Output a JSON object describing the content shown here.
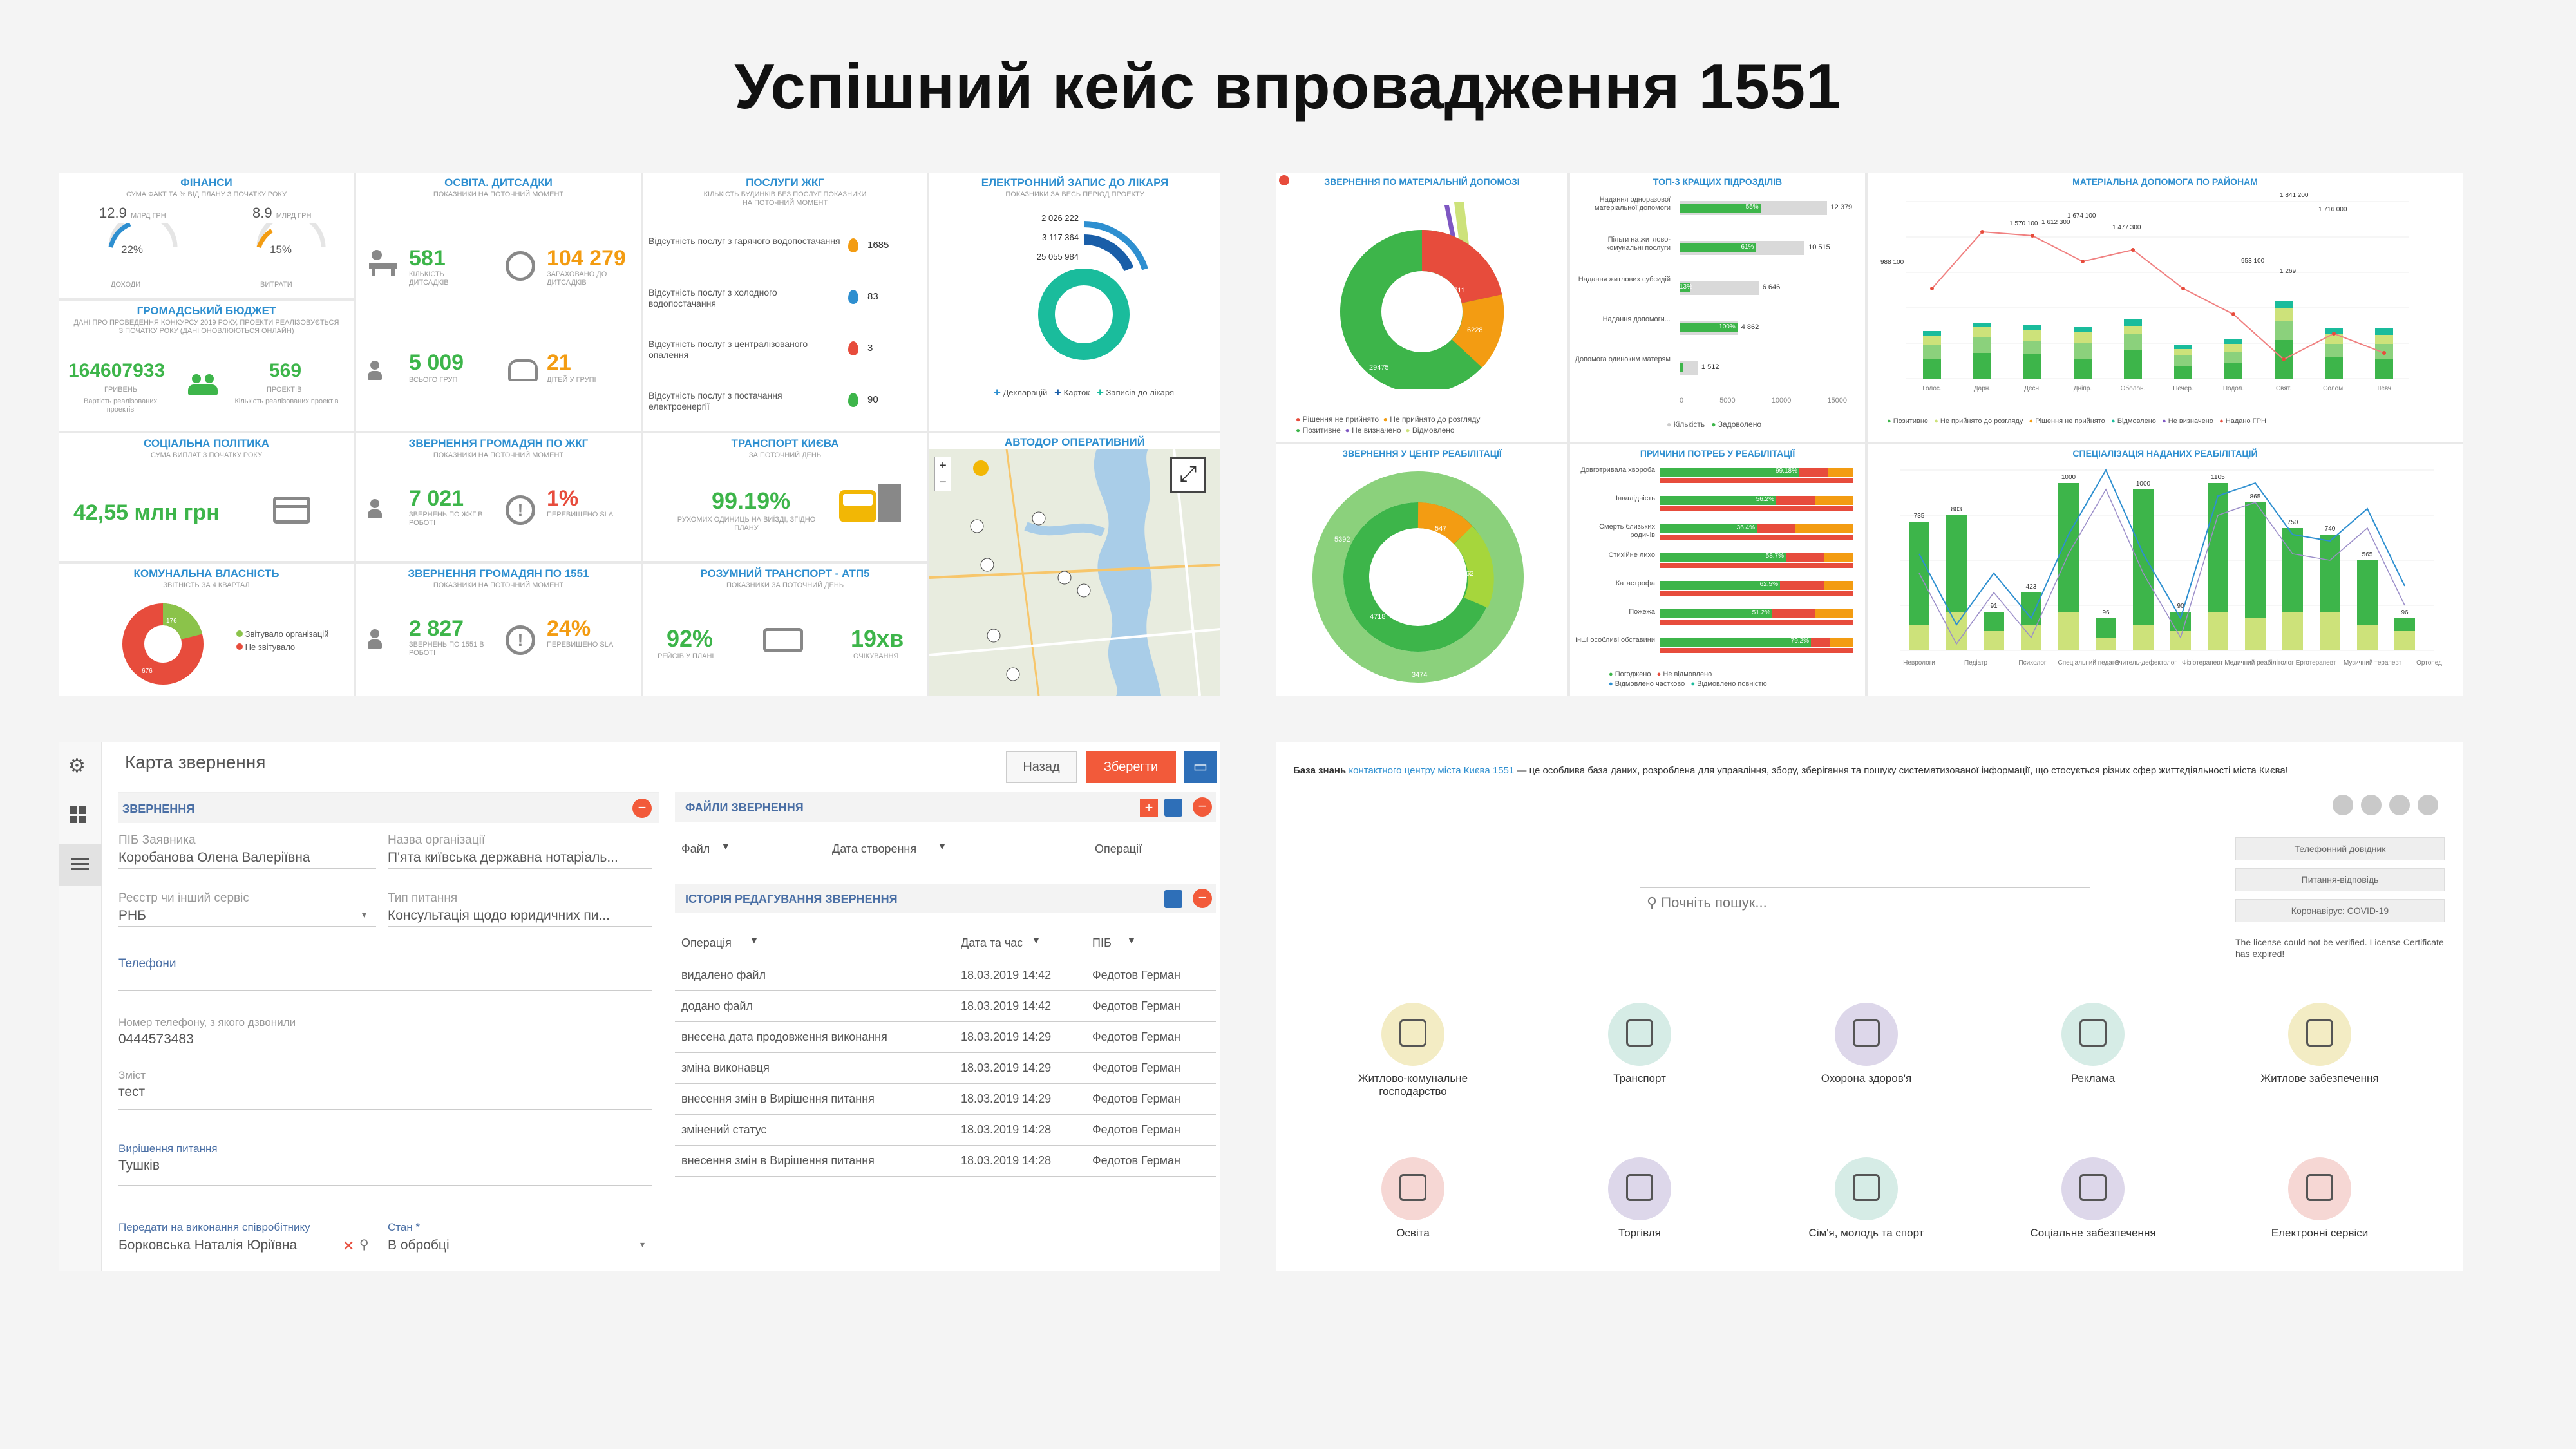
{
  "page_title": "Успішний кейс впровадження 1551",
  "dash1": {
    "finance": {
      "title": "ФІНАНСИ",
      "subtitle": "СУМА ФАКТ ТА % ВІД ПЛАНУ З ПОЧАТКУ РОКУ",
      "left_val": "12.9",
      "left_unit": "млрд грн",
      "right_val": "8.9",
      "right_unit": "млрд грн",
      "left_pct": "22%",
      "right_pct": "15%",
      "left_label": "доходи",
      "right_label": "витрати",
      "left_fill": 0.22,
      "right_fill": 0.15
    },
    "budget": {
      "title": "ГРОМАДСЬКИЙ БЮДЖЕТ",
      "subtitle": "ДАНІ ПРО ПРОВЕДЕННЯ КОНКУРСУ 2019 РОКУ, ПРОЕКТИ РЕАЛІЗОВУЄТЬСЯ З ПОЧАТКУ РОКУ (дані оновлюються онлайн)",
      "amount": "164607933",
      "amount_label": "ГРИВЕНЬ",
      "amount_note": "Вартість реалізованих проектів",
      "projects": "569",
      "projects_label": "ПРОЕКТІВ",
      "projects_note": "Кількість реалізованих проектів"
    },
    "social": {
      "title": "СОЦІАЛЬНА ПОЛІТИКА",
      "subtitle": "СУМА ВИПЛАТ З ПОЧАТКУ РОКУ",
      "value": "42,55 млн грн"
    },
    "communal": {
      "title": "КОМУНАЛЬНА ВЛАСНІСТЬ",
      "subtitle": "ЗВІТНІСТЬ ЗА 4 КВАРТАЛ",
      "leg1": "Звітувало організацій",
      "leg2": "Не звітувало",
      "v1": "176",
      "v2": "676",
      "share": 0.21
    },
    "education": {
      "title": "ОСВІТА. ДИТСАДКИ",
      "subtitle": "ПОКАЗНИКИ НА ПОТОЧНИЙ МОМЕНТ",
      "n1": "581",
      "l1": "КІЛЬКІСТЬ ДИТСАДКІВ",
      "n2": "104 279",
      "l2": "ЗАРАХОВАНО ДО ДИТСАДКІВ",
      "n3": "5 009",
      "l3": "ВСЬОГО ГРУП",
      "n4": "21",
      "l4": "ДІТЕЙ У ГРУПІ"
    },
    "appeals_zhkg": {
      "title": "ЗВЕРНЕННЯ ГРОМАДЯН ПО ЖКГ",
      "subtitle": "ПОКАЗНИКИ НА ПОТОЧНИЙ МОМЕНТ",
      "n1": "7 021",
      "l1": "ЗВЕРНЕНЬ ПО ЖКГ В РОБОТІ",
      "n2": "1%",
      "l2": "ПЕРЕВИЩЕНО SLA"
    },
    "appeals_1551": {
      "title": "ЗВЕРНЕННЯ ГРОМАДЯН ПО 1551",
      "subtitle": "ПОКАЗНИКИ НА ПОТОЧНИЙ МОМЕНТ",
      "n1": "2 827",
      "l1": "ЗВЕРНЕНЬ ПО 1551 В РОБОТІ",
      "n2": "24%",
      "l2": "ПЕРЕВИЩЕНО SLA"
    },
    "housing": {
      "title": "ПОСЛУГИ ЖКГ",
      "subtitle": "КІЛЬКІСТЬ БУДИНКІВ БЕЗ ПОСЛУГ ПОКАЗНИКИ НА ПОТОЧНИЙ МОМЕНТ",
      "rows": [
        {
          "label": "Відсутність послуг з гарячого водопостачання",
          "value": "1685"
        },
        {
          "label": "Відсутність послуг з холодного водопостачання",
          "value": "83"
        },
        {
          "label": "Відсутність послуг з централізованого опалення",
          "value": "3"
        },
        {
          "label": "Відсутність послуг з постачання електроенергії",
          "value": "90"
        }
      ]
    },
    "transport": {
      "title": "ТРАНСПОРТ КИЄВА",
      "subtitle": "ЗА ПОТОЧНИЙ ДЕНЬ",
      "value": "99.19%",
      "label": "РУХОМИХ ОДИНИЦЬ НА ВИЇЗДІ, ЗГІДНО ПЛАНУ"
    },
    "smart": {
      "title": "РОЗУМНИЙ ТРАНСПОРТ - АТП5",
      "subtitle": "ПОКАЗНИКИ ЗА ПОТОЧНИЙ ДЕНЬ",
      "v1": "92%",
      "l1": "РЕЙСІВ У ПЛАНІ",
      "v2": "19хв",
      "l2": "ОЧІКУВАННЯ"
    },
    "doctor": {
      "title": "ЕЛЕКТРОННИЙ ЗАПИС ДО ЛІКАРЯ",
      "subtitle": "ПОКАЗНИКИ ЗА ВЕСЬ ПЕРІОД ПРОЕКТУ",
      "v1": "2 026 222",
      "v2": "3 117 364",
      "v3": "25 055 984",
      "leg": [
        "Декларацій",
        "Карток",
        "Записів до лікаря"
      ]
    },
    "map": {
      "title": "АВТОДОР ОПЕРАТИВНИЙ",
      "zoom_in": "+",
      "zoom_out": "−"
    }
  },
  "dash2": {
    "c1": {
      "title": "ЗВЕРНЕННЯ ПО МАТЕРІАЛЬНІЙ ДОПОМОЗІ",
      "v1": "5711",
      "v2": "6228",
      "v3": "29475",
      "legend": [
        "Рішення не прийнято",
        "Не прийнято до розгляду",
        "Позитивне",
        "Не визначено",
        "Відмовлено"
      ]
    },
    "c2": {
      "title": "ТОП-3 КРАЩИХ ПІДРОЗДІЛІВ",
      "rows": [
        {
          "label": "Надання одноразової матеріальної допомоги",
          "a": "55%",
          "t": "12 379"
        },
        {
          "label": "Пільги на житлово-комунальні послуги",
          "a": "61%",
          "t": "10 515"
        },
        {
          "label": "Надання житлових субсидій",
          "a": "13%",
          "t": "6 646"
        },
        {
          "label": "Надання допомоги...",
          "a": "100%",
          "t": "4 862"
        },
        {
          "label": "Допомога одиноким матерям",
          "a": "",
          "t": "1 512"
        }
      ],
      "axis": [
        "0",
        "5000",
        "10000",
        "15000"
      ],
      "legend": [
        "Кількість",
        "Задоволено"
      ]
    },
    "c3": {
      "title": "МАТЕРІАЛЬНА ДОПОМОГА ПО РАЙОНАМ",
      "peaks": [
        "1 841 200",
        "1 716 000",
        "1 674 100",
        "1 612 300",
        "1 570 100",
        "1 477 300",
        "988 100",
        "953 100",
        "1 269"
      ],
      "xlabels": [
        "Голос.",
        "Дарн.",
        "Десн.",
        "Дніпр.",
        "Оболон.",
        "Печер.",
        "Подол.",
        "Свят.",
        "Солом.",
        "Шевч."
      ],
      "legend": [
        "Позитивне",
        "Не прийнято до розгляду",
        "Рішення не прийнято",
        "Відмовлено",
        "Не визначено",
        "Надано ГРН"
      ]
    },
    "c4": {
      "title": "ЗВЕРНЕННЯ У ЦЕНТР РЕАБІЛІТАЦІЇ",
      "v1": "547",
      "v2": "1962",
      "v3": "4718",
      "v4": "5392",
      "v5": "3474"
    },
    "c5": {
      "title": "ПРИЧИНИ ПОТРЕБ У РЕАБІЛІТАЦІЇ",
      "rows": [
        "Довготривала хвороба",
        "Інвалідність",
        "Смерть близьких родичів",
        "Стихійне лихо",
        "Катастрофа",
        "Пожежа",
        "Інші особливі обставини"
      ],
      "pct": [
        "99.18%",
        "56.2%",
        "36.4%",
        "58.7%",
        "62.5%",
        "51.2%",
        "79.2%"
      ],
      "legend": [
        "Погоджено",
        "Не відмовлено",
        "Відмовлено частково",
        "Відмовлено повністю"
      ]
    },
    "c6": {
      "title": "СПЕЦІАЛІЗАЦІЯ НАДАНИХ РЕАБІЛІТАЦІЙ",
      "top": [
        "735",
        "803",
        "91",
        "423",
        "1000",
        "96",
        "1000",
        "90",
        "1105",
        "865",
        "750",
        "740",
        "565",
        "96"
      ],
      "xlabels": [
        "Неврологи",
        "Педіатр",
        "Психолог",
        "Спеціальний педагог",
        "Вчитель-дефектолог",
        "Фізіотерапевт",
        "Медичний реабілітолог",
        "Ерготерапевт",
        "Музичний терапевт",
        "Ортопед"
      ]
    }
  },
  "form": {
    "title": "Карта звернення",
    "btn_back": "Назад",
    "btn_save": "Зберегти",
    "section": "ЗВЕРНЕННЯ",
    "f_applicant_label": "ПІБ Заявника",
    "f_applicant": "Коробанова Олена Валеріївна",
    "f_org_label": "Назва організації",
    "f_org": "П'ята київська державна нотаріаль...",
    "f_registry_label": "Реєстр чи інший сервіс",
    "f_registry": "РНБ",
    "f_qtype_label": "Тип питання",
    "f_qtype": "Консультація щодо юридичних пи...",
    "f_phones_label": "Телефони",
    "f_callphone_label": "Номер телефону, з якого дзвонили",
    "f_callphone": "0444573483",
    "f_content_label": "Зміст",
    "f_content": "тест",
    "f_solution_label": "Вирішення питання",
    "f_solution": "Тушків",
    "f_assignee_label": "Передати на виконання співробітнику",
    "f_assignee": "Борковська Наталія Юріївна",
    "f_state_label": "Стан *",
    "f_state": "В обробці",
    "files_title": "ФАЙЛИ ЗВЕРНЕННЯ",
    "files_cols": [
      "Файл",
      "Дата створення",
      "Операції"
    ],
    "hist_title": "ІСТОРІЯ РЕДАГУВАННЯ ЗВЕРНЕННЯ",
    "hist_cols": [
      "Операція",
      "Дата та час",
      "ПІБ"
    ],
    "hist_rows": [
      {
        "op": "видалено файл",
        "dt": "18.03.2019 14:42",
        "who": "Федотов Герман"
      },
      {
        "op": "додано файл",
        "dt": "18.03.2019 14:42",
        "who": "Федотов Герман"
      },
      {
        "op": "внесена дата продовження виконання",
        "dt": "18.03.2019 14:29",
        "who": "Федотов Герман"
      },
      {
        "op": "зміна виконавця",
        "dt": "18.03.2019 14:29",
        "who": "Федотов Герман"
      },
      {
        "op": "внесення змін в Вирішення питання",
        "dt": "18.03.2019 14:29",
        "who": "Федотов Герман"
      },
      {
        "op": "змінений статус",
        "dt": "18.03.2019 14:28",
        "who": "Федотов Герман"
      },
      {
        "op": "внесення змін в Вирішення питання",
        "dt": "18.03.2019 14:28",
        "who": "Федотов Герман"
      }
    ]
  },
  "kb": {
    "intro_pre": "База знань ",
    "intro_link": "контактного центру міста Києва 1551",
    "intro_post": " — це особлива база даних, розроблена для управління, збору, зберігання та пошуку систематизованої інформації, що стосується різних сфер життєдіяльності міста Києва!",
    "search_placeholder": "Почніть пошук...",
    "btns": [
      "Телефонний довідник",
      "Питання-відповідь",
      "Коронавірус: COVID-19"
    ],
    "license": "The license could not be verified. License Certificate has expired!",
    "cats": [
      "Житлово-комунальне господарство",
      "Транспорт",
      "Охорона здоров'я",
      "Реклама",
      "Житлове забезпечення",
      "Освіта",
      "Торгівля",
      "Сім'я, молодь та спорт",
      "Соціальне забезпечення",
      "Електронні сервіси"
    ],
    "colors": [
      "#f3ecc4",
      "#d6ece6",
      "#ddd7ea",
      "#d6ece6",
      "#f3ecc4",
      "#f6d7d4",
      "#ddd7ea",
      "#d6ece6",
      "#ddd7ea",
      "#f6d7d4"
    ]
  }
}
